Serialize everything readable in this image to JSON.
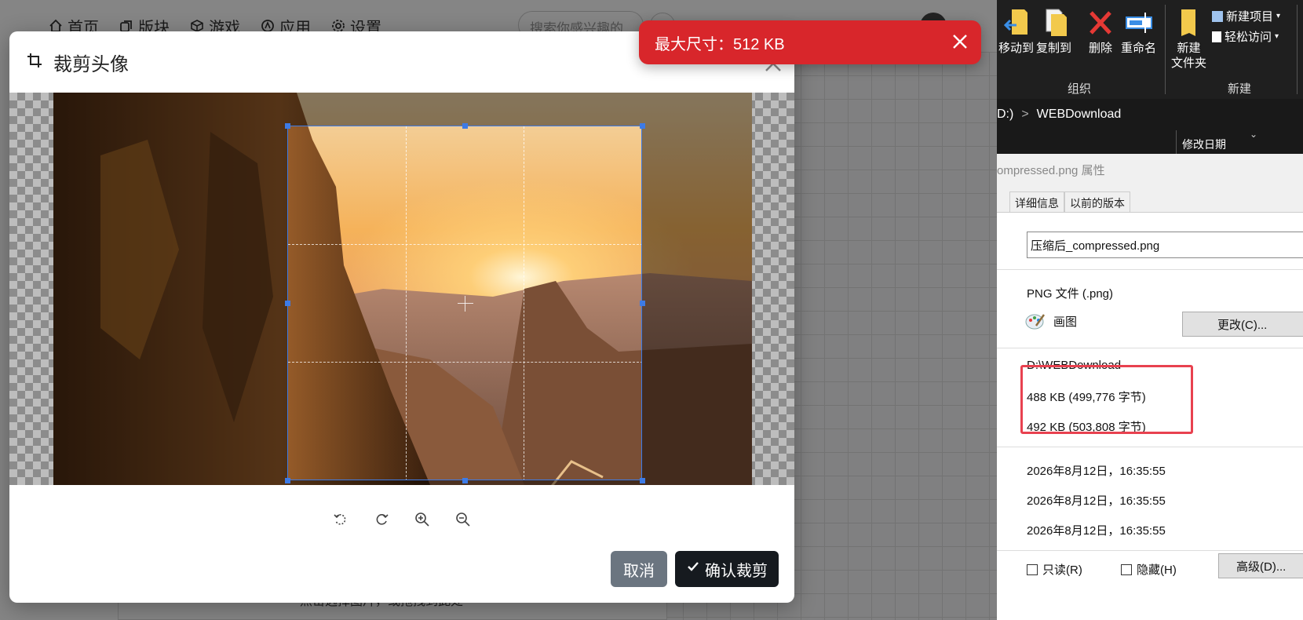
{
  "bg_page": {
    "nav": [
      {
        "label": "首页",
        "icon": "home-icon"
      },
      {
        "label": "版块",
        "icon": "copy-icon"
      },
      {
        "label": "游戏",
        "icon": "cube-icon"
      },
      {
        "label": "应用",
        "icon": "app-icon"
      },
      {
        "label": "设置",
        "icon": "gear-icon"
      }
    ],
    "search_placeholder": "搜索你感兴趣的",
    "card_note": "点击选择图片，或拖拽到此处"
  },
  "dialog": {
    "title": "裁剪头像",
    "title_icon": "crop-icon",
    "tools": [
      {
        "name": "rotate-left-icon"
      },
      {
        "name": "rotate-right-icon"
      },
      {
        "name": "zoom-in-icon"
      },
      {
        "name": "zoom-out-icon"
      }
    ],
    "cancel_label": "取消",
    "confirm_label": "确认裁剪"
  },
  "toast": {
    "message": "最大尺寸：512 KB",
    "color": "#d8262b"
  },
  "explorer": {
    "ribbon": {
      "move_to": "移动到",
      "copy_to": "复制到",
      "delete": "删除",
      "rename": "重命名",
      "new_folder_line1": "新建",
      "new_folder_line2": "文件夹",
      "new_item": "新建项目",
      "easy_access": "轻松访问",
      "group_organize": "组织",
      "group_new": "新建"
    },
    "address": {
      "drive": "D:)",
      "separator": ">",
      "folder": "WEBDownload"
    },
    "column_header": "修改日期"
  },
  "properties": {
    "title": "ompressed.png 属性",
    "tabs": [
      "详细信息",
      "以前的版本"
    ],
    "filename": "压缩后_compressed.png",
    "file_type": "PNG 文件 (.png)",
    "open_with": "画图",
    "change_label": "更改(C)...",
    "location": "D:\\WEBDownload",
    "size": "488 KB (499,776 字节)",
    "size_on_disk": "492 KB (503,808 字节)",
    "created": "2026年8月12日，16:35:55",
    "modified": "2026年8月12日，16:35:55",
    "accessed": "2026年8月12日，16:35:55",
    "readonly_label": "只读(R)",
    "hidden_label": "隐藏(H)",
    "advanced_label": "高级(D)...",
    "highlight_color": "#e8414f"
  }
}
